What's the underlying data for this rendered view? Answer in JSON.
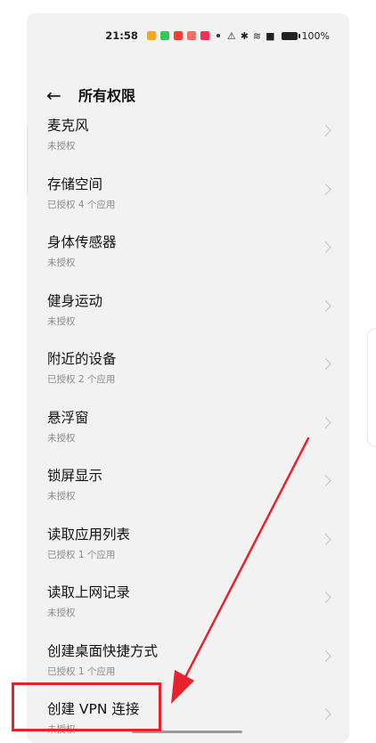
{
  "status_bar": {
    "time": "21:58",
    "battery": "100%",
    "notification_colors": [
      "#f5a623",
      "#34c759",
      "#ff3b30",
      "#ff6b6b",
      "#ff2d55"
    ]
  },
  "header": {
    "title": "所有权限"
  },
  "permissions": [
    {
      "label": "麦克风",
      "status": "未授权"
    },
    {
      "label": "存储空间",
      "status": "已授权 4 个应用"
    },
    {
      "label": "身体传感器",
      "status": "未授权"
    },
    {
      "label": "健身运动",
      "status": "未授权"
    },
    {
      "label": "附近的设备",
      "status": "已授权 2 个应用"
    },
    {
      "label": "悬浮窗",
      "status": "未授权"
    },
    {
      "label": "锁屏显示",
      "status": "未授权"
    },
    {
      "label": "读取应用列表",
      "status": "已授权 1 个应用"
    },
    {
      "label": "读取上网记录",
      "status": "未授权"
    },
    {
      "label": "创建桌面快捷方式",
      "status": "已授权 1 个应用"
    },
    {
      "label": "创建 VPN 连接",
      "status": "未授权"
    }
  ],
  "annotation_color": "#e8212a"
}
